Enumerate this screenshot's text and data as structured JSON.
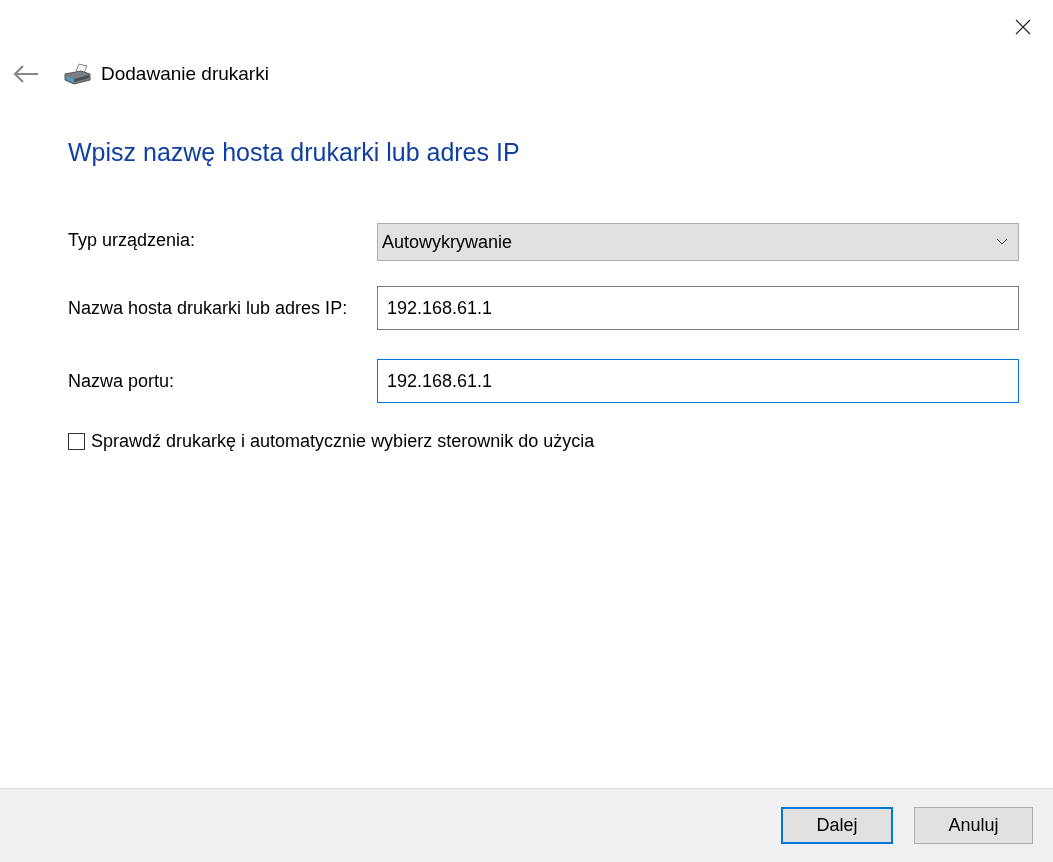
{
  "window": {
    "title": "Dodawanie drukarki"
  },
  "heading": "Wpisz nazwę hosta drukarki lub adres IP",
  "form": [
    {
      "kind": "dropdown",
      "label": "Typ urządzenia:",
      "value": "Autowykrywanie",
      "focused": false
    },
    {
      "kind": "input",
      "label": "Nazwa hosta drukarki lub adres IP:",
      "value": "192.168.61.1",
      "focused": false
    },
    {
      "kind": "input",
      "label": "Nazwa portu:",
      "value": "192.168.61.1",
      "focused": true
    }
  ],
  "checkbox": {
    "label": "Sprawdź drukarkę i automatycznie wybierz sterownik do użycia",
    "checked": false
  },
  "buttons": [
    {
      "label": "Dalej",
      "default": true
    },
    {
      "label": "Anuluj",
      "default": false
    }
  ]
}
